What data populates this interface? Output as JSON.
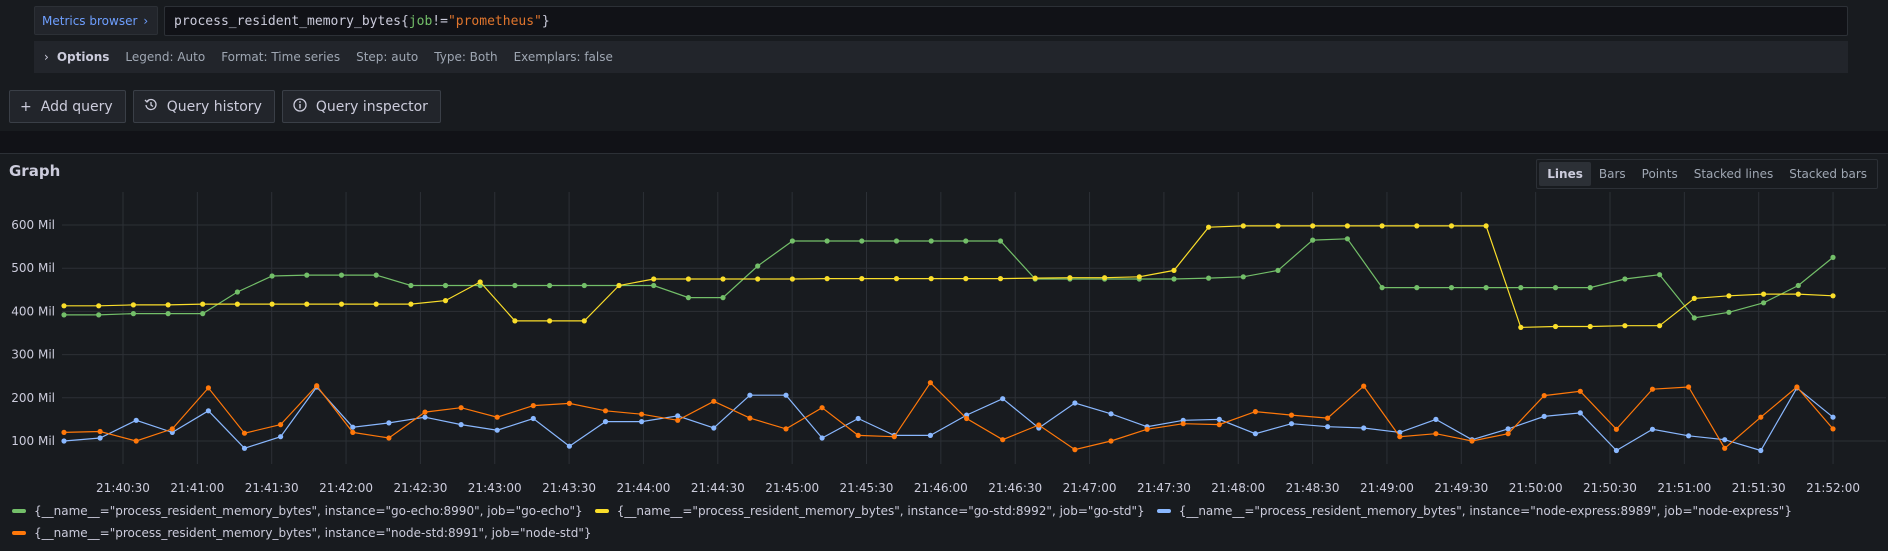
{
  "query": {
    "metrics_browser_label": "Metrics browser",
    "metric": "process_resident_memory_bytes",
    "label_name": "job",
    "operator": "!=",
    "label_value": "\"prometheus\""
  },
  "options": {
    "title": "Options",
    "items": [
      "Legend: Auto",
      "Format: Time series",
      "Step: auto",
      "Type: Both",
      "Exemplars: false"
    ]
  },
  "buttons": {
    "add_query": "Add query",
    "query_history": "Query history",
    "query_inspector": "Query inspector"
  },
  "graph": {
    "title": "Graph",
    "modes": [
      "Lines",
      "Bars",
      "Points",
      "Stacked lines",
      "Stacked bars"
    ],
    "active_mode": "Lines"
  },
  "chart_data": {
    "type": "line",
    "ylabel_ticks": [
      "100 Mil",
      "200 Mil",
      "300 Mil",
      "400 Mil",
      "500 Mil",
      "600 Mil"
    ],
    "x_ticks": [
      "21:40:30",
      "21:41:00",
      "21:41:30",
      "21:42:00",
      "21:42:30",
      "21:43:00",
      "21:43:30",
      "21:44:00",
      "21:44:30",
      "21:45:00",
      "21:45:30",
      "21:46:00",
      "21:46:30",
      "21:47:00",
      "21:47:30",
      "21:48:00",
      "21:48:30",
      "21:49:00",
      "21:49:30",
      "21:50:00",
      "21:50:30",
      "21:51:00",
      "21:51:30",
      "21:52:00"
    ],
    "ylim": [
      70,
      630
    ],
    "xlim": [
      0,
      57
    ],
    "x_step_seconds": 15,
    "grid": true,
    "series": [
      {
        "name": "{__name__=\"process_resident_memory_bytes\", instance=\"go-echo:8990\", job=\"go-echo\"}",
        "color": "#73bf69",
        "values": [
          392,
          392,
          395,
          395,
          395,
          445,
          482,
          484,
          484,
          484,
          460,
          460,
          460,
          460,
          460,
          460,
          460,
          460,
          432,
          432,
          505,
          563,
          563,
          563,
          563,
          563,
          563,
          563,
          475,
          475,
          475,
          475,
          475,
          477,
          480,
          495,
          565,
          568,
          455,
          455,
          455,
          455,
          455,
          455,
          455,
          475,
          485,
          385,
          398,
          420,
          460,
          525
        ]
      },
      {
        "name": "{__name__=\"process_resident_memory_bytes\", instance=\"go-std:8992\", job=\"go-std\"}",
        "color": "#fade2a",
        "values": [
          413,
          413,
          415,
          415,
          417,
          417,
          417,
          417,
          417,
          417,
          417,
          425,
          468,
          378,
          378,
          378,
          460,
          475,
          475,
          475,
          475,
          475,
          476,
          476,
          476,
          476,
          476,
          476,
          477,
          478,
          478,
          480,
          495,
          595,
          598,
          598,
          598,
          598,
          598,
          598,
          598,
          598,
          363,
          365,
          365,
          367,
          367,
          430,
          436,
          440,
          440,
          436
        ]
      },
      {
        "name": "{__name__=\"process_resident_memory_bytes\", instance=\"node-express:8989\", job=\"node-express\"}",
        "color": "#8ab8ff",
        "values": [
          100,
          107,
          148,
          120,
          170,
          83,
          110,
          225,
          132,
          142,
          155,
          138,
          125,
          152,
          88,
          145,
          145,
          158,
          130,
          206,
          206,
          107,
          152,
          113,
          113,
          160,
          198,
          130,
          188,
          163,
          133,
          148,
          150,
          117,
          140,
          133,
          130,
          120,
          150,
          103,
          128,
          157,
          165,
          78,
          127,
          112,
          103,
          78,
          223,
          155
        ]
      },
      {
        "name": "{__name__=\"process_resident_memory_bytes\", instance=\"node-std:8991\", job=\"node-std\"}",
        "color": "#ff780a",
        "values": [
          120,
          122,
          100,
          128,
          223,
          118,
          138,
          228,
          120,
          107,
          167,
          177,
          155,
          182,
          187,
          170,
          162,
          148,
          192,
          153,
          128,
          177,
          113,
          110,
          235,
          152,
          103,
          137,
          80,
          100,
          127,
          140,
          138,
          168,
          160,
          153,
          227,
          110,
          117,
          100,
          117,
          205,
          215,
          127,
          220,
          225,
          83,
          155,
          225,
          128
        ]
      }
    ]
  }
}
